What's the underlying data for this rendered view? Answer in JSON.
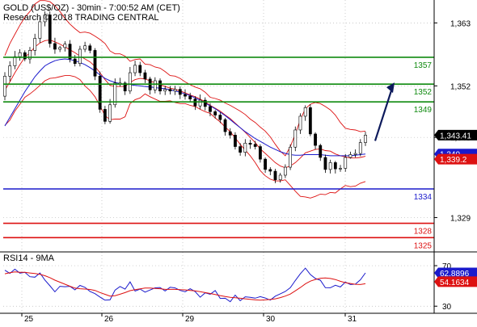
{
  "header": {
    "title": "GOLD (US$/OZ) - 30min - 7:00:52 AM (CET)",
    "source": "Research © 2018 TRADING CENTRAL"
  },
  "chart_data": [
    {
      "type": "candlestick",
      "title": "GOLD (US$/OZ) - 30min - 7:00:52 AM (CET)",
      "ylim": [
        1323,
        1367
      ],
      "y_ticks": [
        "1,363",
        "1,352",
        "1,343",
        "1,329"
      ],
      "x_ticks": [
        "25",
        "26",
        "29",
        "30",
        "31"
      ],
      "grid": true,
      "levels": [
        {
          "label": "1357",
          "value": 1357,
          "color": "#0f8a0f"
        },
        {
          "label": "1352",
          "value": 1352.3,
          "color": "#0f8a0f"
        },
        {
          "label": "1349",
          "value": 1349.2,
          "color": "#0f8a0f"
        },
        {
          "label": "1334",
          "value": 1334,
          "color": "#1a1acc"
        },
        {
          "label": "1328",
          "value": 1328,
          "color": "#dd1111"
        },
        {
          "label": "1325",
          "value": 1325.5,
          "color": "#dd1111"
        }
      ],
      "badges": [
        {
          "label": "1,343.41",
          "value": 1343.4,
          "color": "#000000"
        },
        {
          "label": "1,340",
          "value": 1340.1,
          "color": "#1a1acc"
        },
        {
          "label": "1,339.2",
          "value": 1339.2,
          "color": "#dd1111"
        }
      ],
      "price_close": [
        1353.7,
        1355.5,
        1357.1,
        1357.8,
        1356.7,
        1358.2,
        1360.3,
        1363.2,
        1364.4,
        1359.4,
        1358.4,
        1358.7,
        1359.3,
        1356.7,
        1355.9,
        1358.4,
        1359.0,
        1358.2,
        1353.7,
        1347.9,
        1345.8,
        1348.7,
        1352.5,
        1352.5,
        1351.1,
        1354.3,
        1355.6,
        1354.3,
        1353.2,
        1351.3,
        1352.9,
        1351.1,
        1351.4,
        1351.1,
        1351.4,
        1350.5,
        1350.2,
        1349.7,
        1348.5,
        1349.5,
        1348.4,
        1347.5,
        1346.9,
        1346.1,
        1344.0,
        1343.4,
        1341.4,
        1340.4,
        1342.0,
        1341.8,
        1341.4,
        1339.2,
        1337.4,
        1337.1,
        1335.6,
        1336.4,
        1337.8,
        1341.3,
        1344.3,
        1346.7,
        1348.2,
        1343.6,
        1341.6,
        1339.5,
        1337.4,
        1338.6,
        1337.5,
        1337.6,
        1339.5,
        1340.0,
        1340.2,
        1342.1,
        1343.4
      ],
      "price_open": [
        1350.2,
        1353.7,
        1355.5,
        1357.1,
        1357.8,
        1356.7,
        1358.2,
        1360.3,
        1363.2,
        1364.4,
        1359.4,
        1358.4,
        1358.7,
        1359.3,
        1356.7,
        1355.9,
        1358.4,
        1359.0,
        1358.2,
        1353.7,
        1347.9,
        1345.8,
        1348.7,
        1352.5,
        1352.5,
        1351.1,
        1354.3,
        1355.6,
        1354.3,
        1353.2,
        1351.3,
        1352.9,
        1351.1,
        1351.4,
        1351.1,
        1351.4,
        1350.5,
        1350.2,
        1349.7,
        1348.5,
        1349.5,
        1348.4,
        1347.5,
        1346.9,
        1346.1,
        1344.0,
        1343.4,
        1341.4,
        1340.4,
        1342.0,
        1341.8,
        1341.4,
        1339.2,
        1337.4,
        1337.1,
        1335.6,
        1336.4,
        1337.8,
        1341.3,
        1344.3,
        1346.7,
        1348.2,
        1343.6,
        1341.6,
        1339.5,
        1337.4,
        1338.6,
        1337.5,
        1337.6,
        1339.5,
        1340.0,
        1340.2,
        1342.1
      ],
      "price_high": [
        1354.4,
        1356.3,
        1358.1,
        1358.4,
        1358.2,
        1358.8,
        1361.1,
        1364.0,
        1365.0,
        1365.0,
        1360.4,
        1359.0,
        1359.8,
        1360.0,
        1357.4,
        1359.0,
        1359.7,
        1359.4,
        1358.6,
        1354.5,
        1348.5,
        1349.7,
        1353.3,
        1353.4,
        1352.8,
        1355.3,
        1356.4,
        1356.2,
        1354.8,
        1353.6,
        1353.5,
        1353.3,
        1352.0,
        1352.0,
        1352.0,
        1351.9,
        1351.4,
        1350.8,
        1350.2,
        1350.5,
        1350.0,
        1349.0,
        1347.8,
        1347.4,
        1346.4,
        1344.6,
        1343.9,
        1342.0,
        1342.7,
        1342.6,
        1342.4,
        1341.8,
        1339.5,
        1337.8,
        1337.5,
        1336.8,
        1338.3,
        1341.8,
        1344.9,
        1347.2,
        1348.6,
        1348.8,
        1343.9,
        1341.9,
        1340.0,
        1339.1,
        1338.9,
        1338.2,
        1340.1,
        1340.5,
        1340.9,
        1342.7,
        1344.0
      ],
      "price_low": [
        1349.5,
        1352.8,
        1354.9,
        1356.4,
        1356.3,
        1355.9,
        1357.3,
        1359.5,
        1362.4,
        1358.7,
        1357.6,
        1357.9,
        1358.0,
        1356.1,
        1355.4,
        1355.4,
        1357.9,
        1357.7,
        1353.0,
        1347.3,
        1345.3,
        1345.4,
        1348.2,
        1351.9,
        1350.4,
        1350.6,
        1353.7,
        1353.7,
        1352.5,
        1350.5,
        1350.7,
        1350.5,
        1350.4,
        1350.5,
        1350.4,
        1349.7,
        1349.6,
        1349.1,
        1347.8,
        1347.9,
        1347.7,
        1346.7,
        1346.3,
        1345.5,
        1343.3,
        1342.8,
        1340.9,
        1339.8,
        1339.7,
        1341.0,
        1340.9,
        1338.6,
        1336.8,
        1336.4,
        1335.0,
        1335.1,
        1335.9,
        1337.3,
        1340.6,
        1343.6,
        1345.9,
        1343.2,
        1340.9,
        1338.9,
        1336.8,
        1336.7,
        1336.7,
        1337.0,
        1337.0,
        1339.3,
        1339.5,
        1339.7,
        1341.5
      ],
      "bollinger_upper": [
        1357.3,
        1359.4,
        1361.0,
        1362.6,
        1364.0,
        1365.0,
        1366.3,
        1366.9,
        1366.9,
        1366.7,
        1366.0,
        1365.0,
        1363.8,
        1362.8,
        1362.0,
        1361.3,
        1361.4,
        1361.2,
        1360.7,
        1360.1,
        1359.4,
        1358.1,
        1357.6,
        1357.6,
        1357.2,
        1356.3,
        1356.6,
        1356.7,
        1355.8,
        1355.7,
        1355.3,
        1355.1,
        1354.5,
        1353.8,
        1353.7,
        1353.3,
        1352.7,
        1352.2,
        1351.8,
        1351.5,
        1350.9,
        1350.0,
        1349.8,
        1349.5,
        1349.0,
        1348.6,
        1348.1,
        1347.6,
        1347.0,
        1346.2,
        1345.6,
        1344.8,
        1344.1,
        1343.1,
        1341.8,
        1340.6,
        1339.8,
        1341.4,
        1343.6,
        1346.1,
        1348.0,
        1348.8,
        1349.1,
        1348.9,
        1348.4,
        1347.8,
        1346.9,
        1345.6,
        1344.6,
        1344.4,
        1344.3,
        1344.0,
        1344.1
      ],
      "bollinger_mid": [
        1351.2,
        1352.7,
        1354.3,
        1355.7,
        1357.0,
        1357.8,
        1358.8,
        1359.5,
        1359.9,
        1360.0,
        1359.7,
        1359.3,
        1358.8,
        1358.3,
        1357.8,
        1357.2,
        1356.7,
        1356.2,
        1355.4,
        1354.3,
        1353.1,
        1352.1,
        1351.9,
        1351.9,
        1351.9,
        1352.6,
        1353.1,
        1353.3,
        1353.2,
        1352.9,
        1352.5,
        1352.2,
        1351.9,
        1351.6,
        1351.4,
        1351.1,
        1350.8,
        1350.4,
        1350.1,
        1349.7,
        1349.2,
        1348.6,
        1348.1,
        1347.6,
        1346.9,
        1346.3,
        1345.5,
        1344.7,
        1343.9,
        1343.0,
        1342.1,
        1341.0,
        1340.2,
        1339.4,
        1338.6,
        1338.0,
        1337.7,
        1338.0,
        1338.6,
        1339.4,
        1340.3,
        1340.6,
        1340.9,
        1341.0,
        1340.7,
        1340.6,
        1340.1,
        1339.8,
        1339.6,
        1339.4,
        1339.4,
        1339.5,
        1339.7
      ],
      "bollinger_lower": [
        1345.1,
        1346.0,
        1347.6,
        1348.8,
        1350.0,
        1350.6,
        1351.3,
        1352.1,
        1352.9,
        1353.3,
        1353.4,
        1353.6,
        1353.8,
        1353.8,
        1353.6,
        1353.1,
        1352.0,
        1351.2,
        1350.1,
        1348.5,
        1346.8,
        1346.1,
        1346.2,
        1346.2,
        1346.6,
        1348.9,
        1349.6,
        1349.9,
        1350.6,
        1350.1,
        1349.7,
        1349.3,
        1349.3,
        1349.4,
        1349.1,
        1348.9,
        1348.9,
        1348.6,
        1348.4,
        1347.9,
        1347.5,
        1347.2,
        1346.4,
        1345.7,
        1344.8,
        1344.0,
        1342.9,
        1341.8,
        1340.8,
        1339.8,
        1338.6,
        1337.2,
        1336.3,
        1335.7,
        1335.4,
        1335.4,
        1335.6,
        1334.6,
        1333.6,
        1332.7,
        1332.6,
        1332.4,
        1332.7,
        1333.1,
        1333.0,
        1333.4,
        1333.3,
        1334.0,
        1334.6,
        1334.4,
        1334.5,
        1335.0,
        1335.3
      ],
      "moving_average": [
        1345.0,
        1346.5,
        1348.0,
        1349.5,
        1351.0,
        1352.3,
        1353.6,
        1354.6,
        1355.5,
        1356.0,
        1356.4,
        1356.6,
        1356.7,
        1356.6,
        1356.4,
        1356.1,
        1355.7,
        1355.2,
        1354.6,
        1353.9,
        1353.3,
        1352.9,
        1352.6,
        1352.4,
        1352.3,
        1352.2,
        1352.1,
        1352.0,
        1351.9,
        1351.8,
        1351.7,
        1351.6,
        1351.5,
        1351.3,
        1351.1,
        1350.9,
        1350.6,
        1350.3,
        1349.9,
        1349.5,
        1349.0,
        1348.5,
        1348.0,
        1347.4,
        1346.8,
        1346.1,
        1345.4,
        1344.7,
        1344.0,
        1343.4,
        1342.8,
        1342.3,
        1341.8,
        1341.3,
        1340.9,
        1340.5,
        1340.2,
        1340.0,
        1339.9,
        1339.9,
        1340.0,
        1340.0,
        1340.0,
        1340.0,
        1339.9,
        1339.8,
        1339.8,
        1339.8,
        1339.8,
        1339.8,
        1339.9,
        1340.0,
        1340.1
      ],
      "projection": {
        "from": 1342.4,
        "to": 1352.6
      }
    },
    {
      "type": "line",
      "title": "RSI14 - 9MA",
      "ylim": [
        23,
        82
      ],
      "y_ticks": [
        "70",
        "30"
      ],
      "badges": [
        {
          "label": "62.8896",
          "value": 62.8896,
          "color": "#1a1acc"
        },
        {
          "label": "54.1634",
          "value": 54.1634,
          "color": "#dd1111"
        }
      ],
      "series": [
        {
          "color": "#1a1acc",
          "values": [
            65.5,
            62.4,
            66.5,
            62.6,
            63.4,
            59.1,
            58.6,
            62.8,
            55.8,
            50.1,
            44.2,
            49.6,
            49.2,
            49.6,
            46.1,
            50.5,
            48.6,
            44.6,
            42.4,
            39.0,
            35.9,
            36.2,
            45.9,
            49.5,
            46.8,
            54.0,
            44.9,
            46.9,
            43.9,
            46.0,
            48.1,
            48.4,
            45.0,
            48.7,
            48.0,
            45.6,
            44.3,
            47.2,
            44.4,
            38.9,
            43.2,
            41.8,
            45.4,
            37.7,
            37.8,
            34.4,
            40.9,
            35.4,
            39.3,
            38.7,
            37.9,
            39.4,
            38.1,
            36.0,
            39.9,
            42.2,
            44.5,
            48.3,
            55.4,
            62.0,
            67.6,
            61.3,
            57.4,
            55.6,
            48.3,
            48.2,
            50.7,
            49.0,
            53.8,
            51.4,
            51.8,
            56.1,
            62.9
          ]
        },
        {
          "color": "#dd1111",
          "values": [
            62.0,
            63.0,
            63.9,
            63.5,
            63.4,
            62.8,
            62.2,
            61.4,
            60.1,
            58.2,
            55.7,
            53.7,
            51.7,
            49.7,
            47.9,
            47.2,
            46.9,
            46.5,
            45.6,
            43.5,
            41.7,
            40.0,
            40.4,
            41.8,
            43.4,
            45.3,
            46.3,
            47.1,
            47.9,
            47.9,
            47.5,
            47.2,
            46.6,
            46.6,
            46.6,
            46.3,
            46.1,
            45.6,
            45.1,
            44.4,
            43.4,
            42.5,
            41.6,
            40.5,
            39.5,
            38.8,
            38.4,
            37.8,
            37.3,
            36.7,
            36.2,
            36.0,
            36.2,
            36.6,
            37.3,
            38.5,
            40.0,
            42.0,
            45.2,
            48.4,
            52.0,
            54.7,
            56.4,
            57.6,
            57.9,
            57.4,
            56.3,
            54.6,
            53.2,
            52.4,
            51.6,
            51.4,
            52.2
          ]
        }
      ]
    }
  ]
}
